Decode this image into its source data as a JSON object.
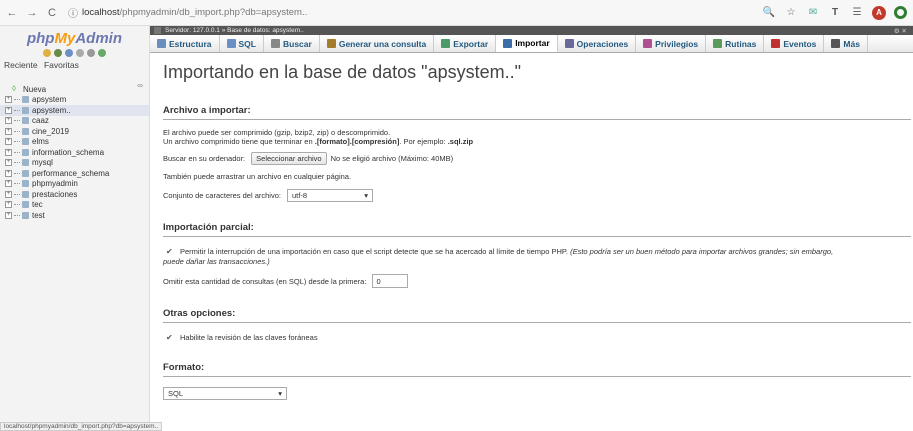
{
  "browser": {
    "back_icon": "←",
    "forward_icon": "→",
    "reload_icon": "C",
    "info_icon": "ⓘ",
    "url_host": "localhost",
    "url_path": "/phpmyadmin/db_import.php?db=apsystem..",
    "zoom_icon": "🔍",
    "star_icon": "☆",
    "ext_icon": "✉",
    "translate_icon": "T",
    "menu_icon": "☰",
    "avatar_letter": "A"
  },
  "sidebar": {
    "logo_php": "php",
    "logo_my": "My",
    "logo_admin": "Admin",
    "recent": "Reciente",
    "favorites": "Favoritas",
    "collapse": "∞",
    "new_label": "Nueva",
    "databases": [
      "apsystem",
      "apsystem..",
      "caaz",
      "cine_2019",
      "elms",
      "information_schema",
      "mysql",
      "performance_schema",
      "phpmyadmin",
      "prestaciones",
      "tec",
      "test"
    ],
    "selected_index": 1
  },
  "server_bar": {
    "text": "Servidor: 127.0.0.1 » Base de datos: apsystem..",
    "right": "⚙ ✕"
  },
  "menu": {
    "tabs": [
      "Estructura",
      "SQL",
      "Buscar",
      "Generar una consulta",
      "Exportar",
      "Importar",
      "Operaciones",
      "Privilegios",
      "Rutinas",
      "Eventos",
      "Más"
    ],
    "active_index": 5
  },
  "main": {
    "heading": "Importando en la base de datos \"apsystem..\"",
    "file_section": {
      "legend": "Archivo a importar:",
      "line1": "El archivo puede ser comprimido (gzip, bzip2, zip) o descomprimido.",
      "line2_prefix": "Un archivo comprimido tiene que terminar en ",
      "line2_bold": ".[formato].[compresión]",
      "line2_mid": ". Por ejemplo: ",
      "line2_example": ".sql.zip",
      "browse_label": "Buscar en su ordenador:",
      "browse_button": "Seleccionar archivo",
      "no_file": "No se eligió archivo (Máximo: 40MB)",
      "drag_text": "También puede arrastrar un archivo en cualquier página.",
      "charset_label": "Conjunto de caracteres del archivo:",
      "charset_value": "utf-8"
    },
    "partial_section": {
      "legend": "Importación parcial:",
      "allow_text": "Permitir la interrupción de una importación en caso que el script detecte que se ha acercado al límite de tiempo PHP.",
      "allow_italic": "(Esto podría ser un buen método para importar archivos grandes; sin embargo,",
      "allow_italic2": "puede dañar las transacciones.)",
      "skip_label": "Omitir esta cantidad de consultas (en SQL) desde la primera:",
      "skip_value": "0"
    },
    "other_section": {
      "legend": "Otras opciones:",
      "fk_text": "Habilite la revisión de las claves foráneas"
    },
    "format_section": {
      "legend": "Formato:",
      "format_value": "SQL"
    }
  },
  "status_bar": {
    "text": "localhost/phpmyadmin/db_import.php?db=apsystem.."
  },
  "colors": {
    "link": "#235a81",
    "logo_blue": "#6c78af",
    "logo_orange": "#f89c0e"
  }
}
